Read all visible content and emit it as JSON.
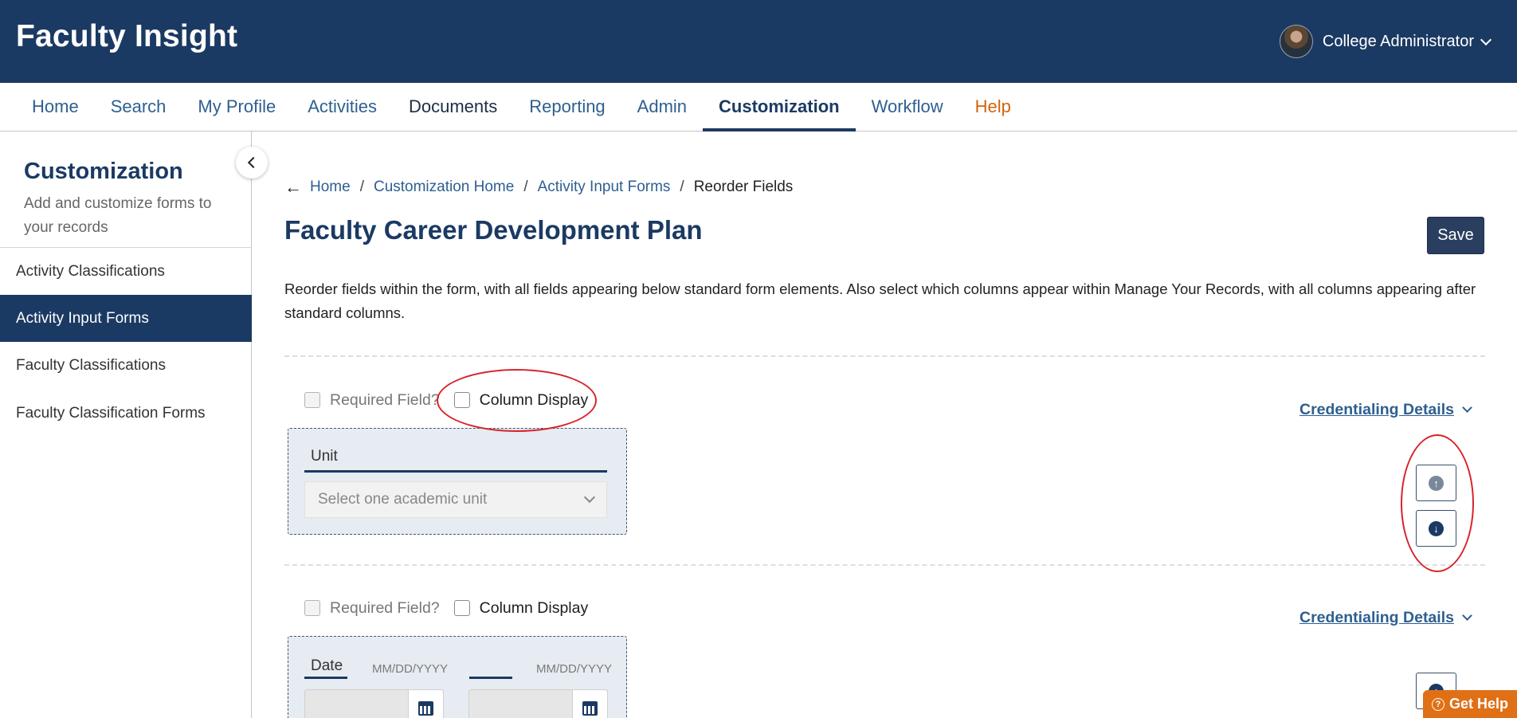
{
  "app": {
    "title": "Faculty Insight"
  },
  "user": {
    "name": "College Administrator",
    "avatar_icon": "user-avatar"
  },
  "nav": {
    "items": [
      {
        "label": "Home"
      },
      {
        "label": "Search"
      },
      {
        "label": "My Profile"
      },
      {
        "label": "Activities"
      },
      {
        "label": "Documents"
      },
      {
        "label": "Reporting"
      },
      {
        "label": "Admin"
      },
      {
        "label": "Customization",
        "active": true
      },
      {
        "label": "Workflow"
      },
      {
        "label": "Help"
      }
    ]
  },
  "sidebar": {
    "title": "Customization",
    "subtitle": "Add and customize forms to your records",
    "items": [
      {
        "label": "Activity Classifications"
      },
      {
        "label": "Activity Input Forms",
        "active": true
      },
      {
        "label": "Faculty Classifications"
      },
      {
        "label": "Faculty Classification Forms"
      }
    ]
  },
  "breadcrumb": {
    "back_icon": "arrow-left-icon",
    "items": [
      "Home",
      "Customization Home",
      "Activity Input Forms"
    ],
    "current": "Reorder Fields",
    "separator": "/"
  },
  "page": {
    "title": "Faculty Career Development Plan",
    "save_label": "Save",
    "description": "Reorder fields within the form, with all fields appearing below standard form elements. Also select which columns appear within Manage Your Records, with all columns appearing after standard columns."
  },
  "fields": [
    {
      "required_label": "Required Field?",
      "column_label": "Column Display",
      "details_label": "Credentialing Details",
      "field_label": "Unit",
      "select_placeholder": "Select one academic unit"
    },
    {
      "required_label": "Required Field?",
      "column_label": "Column Display",
      "details_label": "Credentialing Details",
      "field_label": "Date",
      "date_placeholder_start": "MM/DD/YYYY",
      "date_placeholder_end": "MM/DD/YYYY"
    }
  ],
  "colors": {
    "brand": "#1b3a63",
    "link": "#2e5f90",
    "help": "#d2640a",
    "annotation": "#d8232a"
  },
  "help_button": {
    "label": "Get Help"
  }
}
